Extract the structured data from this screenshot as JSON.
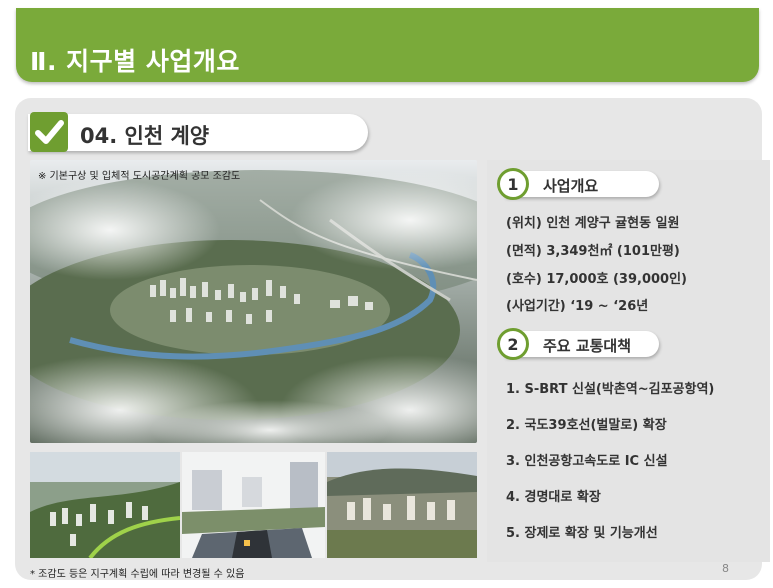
{
  "header": {
    "title": "Ⅱ. 지구별 사업개요"
  },
  "district": {
    "title": "04. 인천 계양",
    "check_icon": "check-icon"
  },
  "image": {
    "caption": "※ 기본구상 및 입체적 도시공간계획 공모 조감도"
  },
  "section1": {
    "number": "1",
    "title": "사업개요",
    "lines": [
      "(위치) 인천 계양구 귤현동 일원",
      "(면적) 3,349천㎡ (101만평)",
      "(호수) 17,000호 (39,000인)",
      "(사업기간) ‘19 ~ ‘26년"
    ]
  },
  "section2": {
    "number": "2",
    "title": "주요 교통대책",
    "items": [
      "1. S-BRT 신설(박촌역~김포공항역)",
      "2. 국도39호선(벌말로) 확장",
      "3. 인천공항고속도로 IC 신설",
      "4. 경명대로 확장",
      "5. 장제로 확장 및 기능개선"
    ]
  },
  "footnote": "* 조감도 등은 지구계획 수립에 따라 변경될 수 있음",
  "page_number": "8",
  "colors": {
    "accent_green": "#7aaa3a",
    "panel_gray": "#e7e7e7"
  }
}
